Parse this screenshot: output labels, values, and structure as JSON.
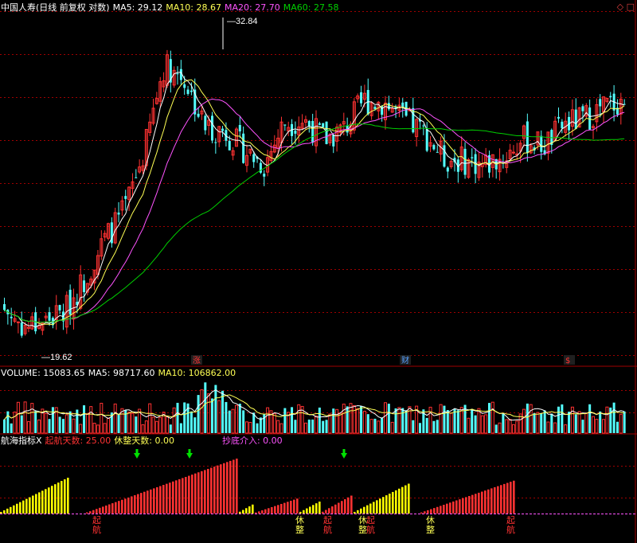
{
  "header": {
    "stock_title": "中国人寿(日线 前复权 对数)",
    "ma5_label": "MA5: 29.12",
    "ma10_label": "MA10: 28.67",
    "ma20_label": "MA20: 27.70",
    "ma60_label": "MA60: 27.58",
    "corner_icons": "◇ □"
  },
  "volume_header": {
    "volume_label": "VOLUME: 15083.65",
    "ma5_label": "MA5: 98717.60",
    "ma10_label": "MA10: 106862.00"
  },
  "indicator_header": {
    "name": "航海指标X",
    "qihang_label": "起航天数: 25.00",
    "xiuzheng_label": "休整天数: 0.00",
    "chaodi_label": "抄底介入: 0.00"
  },
  "markers": {
    "zhang": "涨",
    "cai": "财",
    "dollar": "$"
  },
  "colors": {
    "up": "#ff3232",
    "down": "#54ffff",
    "ma5": "#ffffff",
    "ma10": "#ffff54",
    "ma20": "#ff54ff",
    "ma60": "#00d000",
    "grid": "#a00000",
    "yellow_bar": "#ffff00"
  },
  "chart_data": {
    "type": "candlestick",
    "price_axis": {
      "ylim": [
        18.8,
        34.2
      ],
      "scale": "log"
    },
    "high_label": "32.84",
    "low_label": "19.62",
    "price_path": [
      20.5,
      19.9,
      20.1,
      20.4,
      21.6,
      23.1,
      24.3,
      26.9,
      31.3,
      30.5,
      28.1,
      27.9,
      27.0,
      26.3,
      28.3,
      28.4,
      27.5,
      28.0,
      29.4,
      29.3,
      28.4,
      27.8,
      26.6,
      26.5,
      26.3,
      26.7,
      27.5,
      27.2,
      28.2,
      28.5,
      29.1,
      29.4
    ],
    "volume_max": 300000,
    "signal_labels": {
      "qihang": "起航",
      "xiuzheng": "休整"
    },
    "indicator_segments": [
      {
        "bars": 22,
        "yellow": true,
        "max": 0.6
      },
      {
        "bars": 5,
        "yellow": false,
        "max": 0.0
      },
      {
        "bars": 48,
        "yellow": false,
        "max": 0.92
      },
      {
        "bars": 5,
        "yellow": true,
        "max": 0.15
      },
      {
        "bars": 14,
        "yellow": false,
        "max": 0.25
      },
      {
        "bars": 7,
        "yellow": true,
        "max": 0.2
      },
      {
        "bars": 10,
        "yellow": false,
        "max": 0.3
      },
      {
        "bars": 18,
        "yellow": true,
        "max": 0.5
      },
      {
        "bars": 3,
        "yellow": false,
        "max": 0.0
      },
      {
        "bars": 30,
        "yellow": false,
        "max": 0.55
      }
    ]
  }
}
